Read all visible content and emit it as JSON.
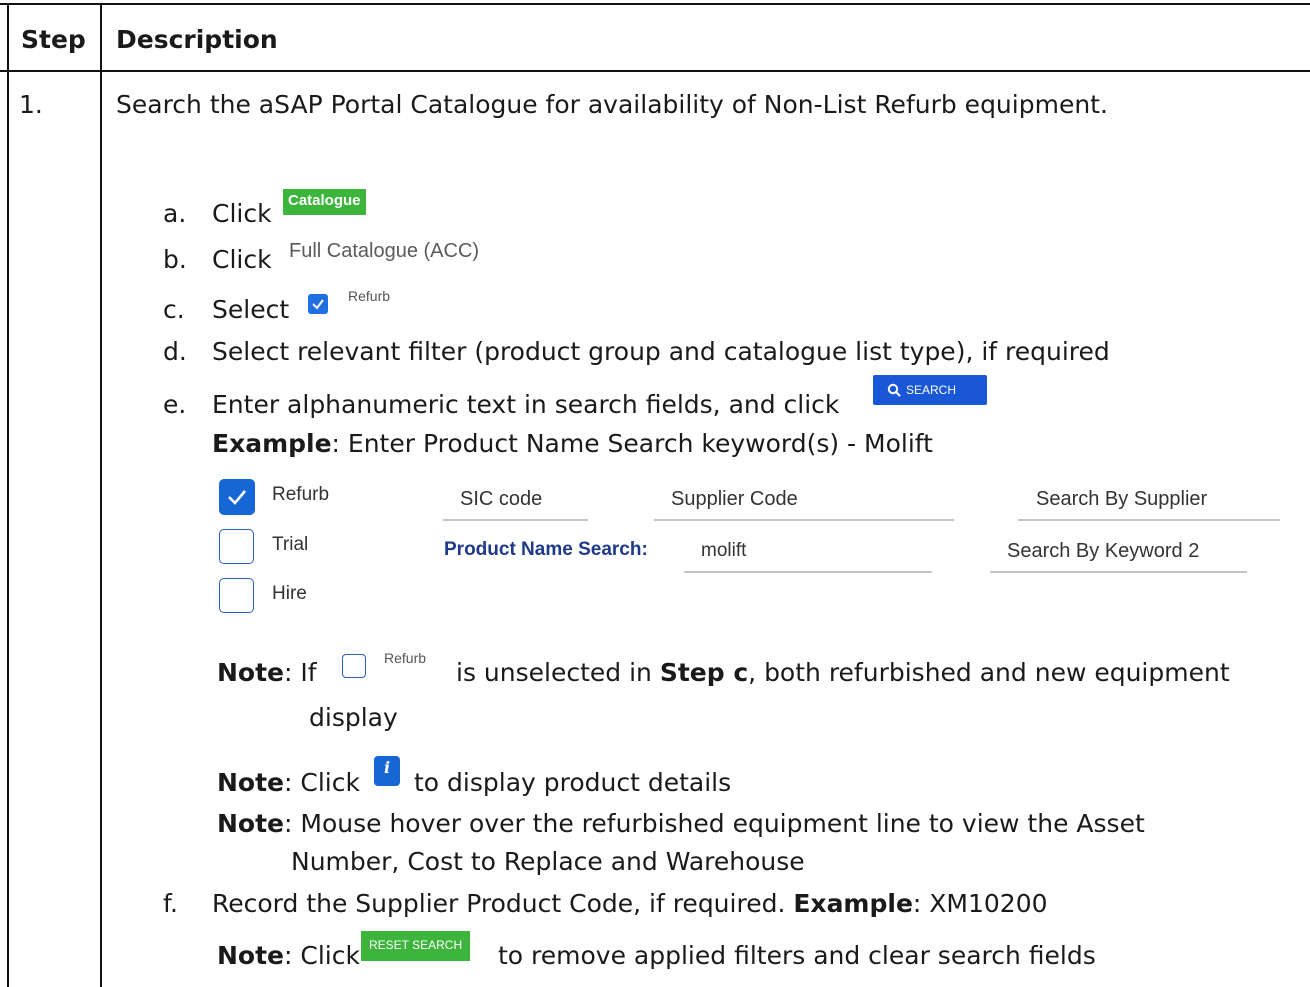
{
  "table": {
    "header_step": "Step",
    "header_description": "Description",
    "step_number": "1.",
    "intro": "Search the aSAP Portal Catalogue for availability of Non-List Refurb equipment."
  },
  "items": {
    "a": {
      "marker": "a.",
      "text": "Click",
      "button": "Catalogue"
    },
    "b": {
      "marker": "b.",
      "text": "Click",
      "link": "Full Catalogue (ACC)"
    },
    "c": {
      "marker": "c.",
      "text": "Select",
      "checkbox_label": "Refurb"
    },
    "d": {
      "marker": "d.",
      "text": "Select relevant filter (product group and catalogue list type), if required"
    },
    "e": {
      "marker": "e.",
      "text": "Enter alphanumeric text in search fields, and click",
      "search_button": "SEARCH",
      "example_label": "Example",
      "example_text": ": Enter Product Name Search keyword(s) - Molift"
    },
    "f": {
      "marker": "f.",
      "text": "Record the Supplier Product Code, if required.",
      "example_label": "Example",
      "example_text": ": XM10200"
    }
  },
  "filter_panel": {
    "checkboxes": [
      {
        "label": "Refurb",
        "checked": true
      },
      {
        "label": "Trial",
        "checked": false
      },
      {
        "label": "Hire",
        "checked": false
      }
    ],
    "sic_code": "SIC code",
    "supplier_code": "Supplier Code",
    "search_by_supplier": "Search By Supplier",
    "product_name_label": "Product Name Search:",
    "product_name_value": "molift",
    "search_by_keyword2": "Search By Keyword 2"
  },
  "notes": {
    "note_label": "Note",
    "note1_prefix": ":  If",
    "note1_checkbox_label": "Refurb",
    "note1_mid": "is unselected in",
    "note1_step": "Step c",
    "note1_suffix": ", both refurbished and new equipment",
    "note1_line2": "display",
    "note2_prefix": ": Click",
    "note2_suffix": "to display product details",
    "info_glyph": "i",
    "note3_line1": ": Mouse hover over the refurbished equipment line to view the Asset",
    "note3_line2": "Number, Cost to Replace and Warehouse",
    "note4_prefix": ": Click",
    "reset_button": "RESET SEARCH",
    "note4_suffix": "to remove applied filters and clear search fields"
  },
  "colors": {
    "green_button": "#3db53d",
    "blue_button": "#1a57d6",
    "checkbox_blue": "#1f6fe0"
  }
}
